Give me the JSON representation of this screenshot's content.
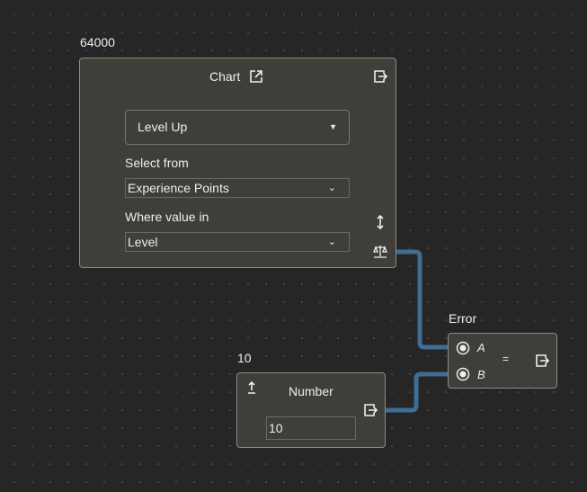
{
  "wire_color": "#3f6d93",
  "chart_node": {
    "caption": "64000",
    "title": "Chart",
    "dropdown": "Level Up",
    "select_from_label": "Select from",
    "select_from_value": "Experience Points",
    "where_label": "Where value in",
    "where_value": "Level",
    "icons": [
      "external-link-icon",
      "output-icon",
      "vertical-resize-icon",
      "scale-icon"
    ]
  },
  "number_node": {
    "caption": "10",
    "title": "Number",
    "value": "10"
  },
  "error_node": {
    "caption": "Error",
    "input_a": "A",
    "input_b": "B",
    "operator": "="
  }
}
